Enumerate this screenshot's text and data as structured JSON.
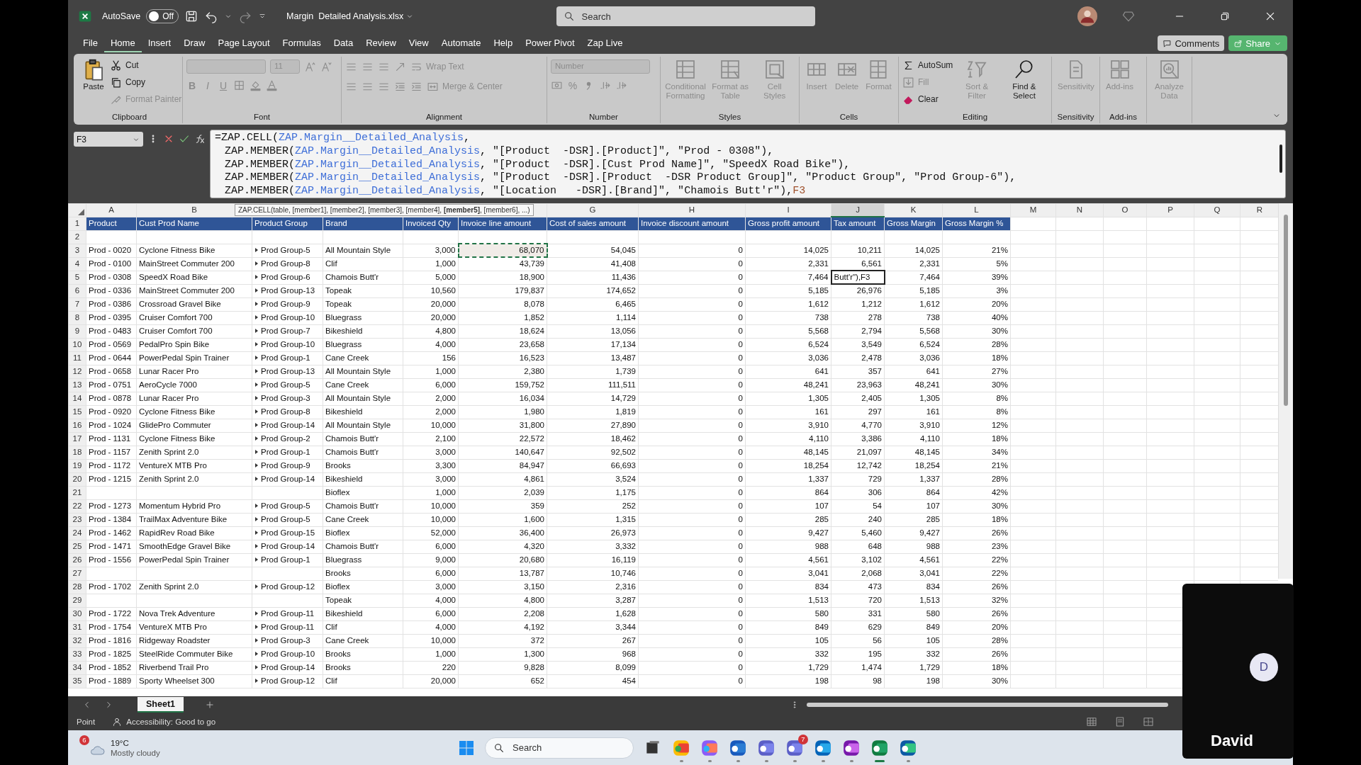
{
  "title_bar": {
    "autosave_label": "AutoSave",
    "autosave": {
      "on": false,
      "label": "Off"
    },
    "file_name": "Margin  Detailed Analysis.xlsx",
    "search_placeholder": "Search"
  },
  "tabs": [
    {
      "label": "File",
      "selected": false
    },
    {
      "label": "Home",
      "selected": true
    },
    {
      "label": "Insert",
      "selected": false
    },
    {
      "label": "Draw",
      "selected": false
    },
    {
      "label": "Page Layout",
      "selected": false
    },
    {
      "label": "Formulas",
      "selected": false
    },
    {
      "label": "Data",
      "selected": false
    },
    {
      "label": "Review",
      "selected": false
    },
    {
      "label": "View",
      "selected": false
    },
    {
      "label": "Automate",
      "selected": false
    },
    {
      "label": "Help",
      "selected": false
    },
    {
      "label": "Power Pivot",
      "selected": false
    },
    {
      "label": "Zap Live",
      "selected": false
    }
  ],
  "buttons": {
    "comments": "Comments",
    "share": "Share"
  },
  "ribbon": {
    "clipboard": {
      "label": "Clipboard",
      "paste": {
        "label": "Paste",
        "disabled": false
      },
      "cut": {
        "label": "Cut",
        "disabled": false
      },
      "copy": {
        "label": "Copy",
        "disabled": false
      },
      "format_painter": {
        "label": "Format Painter",
        "disabled": true
      }
    },
    "font": {
      "label": "Font",
      "size": "11",
      "bold": "B",
      "italic": "I",
      "underline": "U"
    },
    "alignment": {
      "label": "Alignment",
      "wrap_text": "Wrap Text",
      "merge_center": "Merge & Center"
    },
    "number": {
      "label": "Number",
      "format": "Number",
      "percent": "%"
    },
    "styles": {
      "label": "Styles",
      "conditional_formatting": "Conditional Formatting",
      "format_as_table": "Format as Table",
      "cell_styles": "Cell Styles"
    },
    "cells": {
      "label": "Cells",
      "insert": "Insert",
      "delete": "Delete",
      "format": "Format"
    },
    "editing": {
      "label": "Editing",
      "autosum": {
        "label": "AutoSum",
        "disabled": false
      },
      "fill": {
        "label": "Fill",
        "disabled": true
      },
      "clear": {
        "label": "Clear",
        "disabled": false
      },
      "sort_filter": {
        "label": "Sort & Filter",
        "disabled": true
      },
      "find_select": {
        "label": "Find & Select",
        "disabled": false
      }
    },
    "sensitivity": {
      "label": "Sensitivity",
      "button": "Sensitivity"
    },
    "add_ins": {
      "label": "Add-ins",
      "button": "Add-ins"
    },
    "analyze_data": "Analyze Data"
  },
  "formula_bar": {
    "name_box": "F3",
    "lines": [
      [
        {
          "text": "=ZAP.CELL(",
          "kind": "plain"
        },
        {
          "text": "ZAP.Margin__Detailed_Analysis",
          "kind": "ref"
        },
        {
          "text": ",",
          "kind": "plain"
        }
      ],
      [
        {
          "text": "ZAP.MEMBER(",
          "kind": "plain"
        },
        {
          "text": "ZAP.Margin__Detailed_Analysis",
          "kind": "ref"
        },
        {
          "text": ", \"[Product  -DSR].[Product]\", \"Prod - 0308\"),",
          "kind": "plain"
        }
      ],
      [
        {
          "text": "ZAP.MEMBER(",
          "kind": "plain"
        },
        {
          "text": "ZAP.Margin__Detailed_Analysis",
          "kind": "ref"
        },
        {
          "text": ", \"[Product  -DSR].[Cust Prod Name]\", \"SpeedX Road Bike\"),",
          "kind": "plain"
        }
      ],
      [
        {
          "text": "ZAP.MEMBER(",
          "kind": "plain"
        },
        {
          "text": "ZAP.Margin__Detailed_Analysis",
          "kind": "ref"
        },
        {
          "text": ", \"[Product  -DSR].[Product  -DSR Product Group]\", \"Product Group\", \"Prod Group-6\"),",
          "kind": "plain"
        }
      ],
      [
        {
          "text": "ZAP.MEMBER(",
          "kind": "plain"
        },
        {
          "text": "ZAP.Margin__Detailed_Analysis",
          "kind": "ref"
        },
        {
          "text": ", \"[Location   -DSR].[Brand]\", \"Chamois Butt'r\"),",
          "kind": "plain"
        },
        {
          "text": "F3",
          "kind": "cell"
        }
      ]
    ]
  },
  "tooltip": "ZAP.CELL(table, [member1], [member2], [member3], [member4], **[member5]**, [member6], ...)",
  "grid": {
    "columns": [
      {
        "letter": "A",
        "selected": false
      },
      {
        "letter": "B",
        "selected": false
      },
      {
        "selected": false
      },
      {
        "selected": false
      },
      {
        "selected": false
      },
      {
        "selected": false
      },
      {
        "letter": "G",
        "selected": false
      },
      {
        "letter": "H",
        "selected": false
      },
      {
        "letter": "I",
        "selected": false
      },
      {
        "letter": "J",
        "selected": true
      },
      {
        "letter": "K",
        "selected": false
      },
      {
        "letter": "L",
        "selected": false
      },
      {
        "letter": "M",
        "selected": false
      },
      {
        "letter": "N",
        "selected": false
      },
      {
        "letter": "O",
        "selected": false
      },
      {
        "letter": "P",
        "selected": false
      },
      {
        "letter": "Q",
        "selected": false
      },
      {
        "letter": "R",
        "selected": false
      }
    ],
    "rows": [
      {
        "number": "1",
        "kind": "header",
        "cells": [
          "Product",
          "Cust Prod Name",
          "Product Group",
          "Brand",
          "Invoiced Qty",
          "Invoice line amount",
          "Cost of sales amount",
          "Invoice discount amount",
          "Gross profit amount",
          "Tax amount",
          "Gross Margin",
          "Gross Margin %"
        ]
      },
      {
        "number": "2",
        "kind": "blank"
      },
      {
        "number": "3",
        "kind": "data",
        "cells": [
          "Prod - 0020",
          "Cyclone Fitness Bike",
          "Prod Group-5",
          "All Mountain Style",
          "3,000",
          {
            "text": "68,070",
            "copied": true
          },
          "54,045",
          "0",
          "14,025",
          "10,211",
          "14,025",
          "21%"
        ]
      },
      {
        "number": "4",
        "kind": "data",
        "cells": [
          "Prod - 0100",
          "MainStreet Commuter 200",
          "Prod Group-8",
          "Clif",
          "1,000",
          "43,739",
          "41,408",
          "0",
          "2,331",
          "6,561",
          "2,331",
          "5%"
        ]
      },
      {
        "number": "5",
        "kind": "data",
        "cells": [
          "Prod - 0308",
          "SpeedX Road Bike",
          "Prod Group-6",
          "Chamois Butt'r",
          "5,000",
          "18,900",
          "11,436",
          "0",
          "7,464",
          {
            "text": "Butt'r\"),F3",
            "editing": true
          },
          "7,464",
          "39%"
        ]
      },
      {
        "number": "6",
        "kind": "data",
        "cells": [
          "Prod - 0336",
          "MainStreet Commuter 200",
          "Prod Group-13",
          "Topeak",
          "10,560",
          "179,837",
          "174,652",
          "0",
          "5,185",
          "26,976",
          "5,185",
          "3%"
        ]
      },
      {
        "number": "7",
        "kind": "data",
        "cells": [
          "Prod - 0386",
          "Crossroad Gravel Bike",
          "Prod Group-9",
          "Topeak",
          "20,000",
          "8,078",
          "6,465",
          "0",
          "1,612",
          "1,212",
          "1,612",
          "20%"
        ]
      },
      {
        "number": "8",
        "kind": "data",
        "cells": [
          "Prod - 0395",
          "Cruiser Comfort 700",
          "Prod Group-10",
          "Bluegrass",
          "20,000",
          "1,852",
          "1,114",
          "0",
          "738",
          "278",
          "738",
          "40%"
        ]
      },
      {
        "number": "9",
        "kind": "data",
        "cells": [
          "Prod - 0483",
          "Cruiser Comfort 700",
          "Prod Group-7",
          "Bikeshield",
          "4,800",
          "18,624",
          "13,056",
          "0",
          "5,568",
          "2,794",
          "5,568",
          "30%"
        ]
      },
      {
        "number": "10",
        "kind": "data",
        "cells": [
          "Prod - 0569",
          "PedalPro Spin Bike",
          "Prod Group-10",
          "Bluegrass",
          "4,000",
          "23,658",
          "17,134",
          "0",
          "6,524",
          "3,549",
          "6,524",
          "28%"
        ]
      },
      {
        "number": "11",
        "kind": "data",
        "cells": [
          "Prod - 0644",
          "PowerPedal Spin Trainer",
          "Prod Group-1",
          "Cane Creek",
          "156",
          "16,523",
          "13,487",
          "0",
          "3,036",
          "2,478",
          "3,036",
          "18%"
        ]
      },
      {
        "number": "12",
        "kind": "data",
        "cells": [
          "Prod - 0658",
          "Lunar Racer Pro",
          "Prod Group-13",
          "All Mountain Style",
          "1,000",
          "2,380",
          "1,739",
          "0",
          "641",
          "357",
          "641",
          "27%"
        ]
      },
      {
        "number": "13",
        "kind": "data",
        "cells": [
          "Prod - 0751",
          "AeroCycle 7000",
          "Prod Group-5",
          "Cane Creek",
          "6,000",
          "159,752",
          "111,511",
          "0",
          "48,241",
          "23,963",
          "48,241",
          "30%"
        ]
      },
      {
        "number": "14",
        "kind": "data",
        "cells": [
          "Prod - 0878",
          "Lunar Racer Pro",
          "Prod Group-3",
          "All Mountain Style",
          "2,000",
          "16,034",
          "14,729",
          "0",
          "1,305",
          "2,405",
          "1,305",
          "8%"
        ]
      },
      {
        "number": "15",
        "kind": "data",
        "cells": [
          "Prod - 0920",
          "Cyclone Fitness Bike",
          "Prod Group-8",
          "Bikeshield",
          "2,000",
          "1,980",
          "1,819",
          "0",
          "161",
          "297",
          "161",
          "8%"
        ]
      },
      {
        "number": "16",
        "kind": "data",
        "cells": [
          "Prod - 1024",
          "GlidePro Commuter",
          "Prod Group-14",
          "All Mountain Style",
          "10,000",
          "31,800",
          "27,890",
          "0",
          "3,910",
          "4,770",
          "3,910",
          "12%"
        ]
      },
      {
        "number": "17",
        "kind": "data",
        "cells": [
          "Prod - 1131",
          "Cyclone Fitness Bike",
          "Prod Group-2",
          "Chamois Butt'r",
          "2,100",
          "22,572",
          "18,462",
          "0",
          "4,110",
          "3,386",
          "4,110",
          "18%"
        ]
      },
      {
        "number": "18",
        "kind": "data",
        "cells": [
          "Prod - 1157",
          "Zenith Sprint 2.0",
          "Prod Group-1",
          "Chamois Butt'r",
          "3,000",
          "140,647",
          "92,502",
          "0",
          "48,145",
          "21,097",
          "48,145",
          "34%"
        ]
      },
      {
        "number": "19",
        "kind": "data",
        "cells": [
          "Prod - 1172",
          "VentureX MTB Pro",
          "Prod Group-9",
          "Brooks",
          "3,300",
          "84,947",
          "66,693",
          "0",
          "18,254",
          "12,742",
          "18,254",
          "21%"
        ]
      },
      {
        "number": "20",
        "kind": "data",
        "cells": [
          "Prod - 1215",
          "Zenith Sprint 2.0",
          "Prod Group-14",
          "Bikeshield",
          "3,000",
          "4,861",
          "3,524",
          "0",
          "1,337",
          "729",
          "1,337",
          "28%"
        ]
      },
      {
        "number": "21",
        "kind": "data",
        "cells": [
          null,
          null,
          null,
          "Bioflex",
          "1,000",
          "2,039",
          "1,175",
          "0",
          "864",
          "306",
          "864",
          "42%"
        ]
      },
      {
        "number": "22",
        "kind": "data",
        "cells": [
          "Prod - 1273",
          "Momentum Hybrid Pro",
          "Prod Group-5",
          "Chamois Butt'r",
          "10,000",
          "359",
          "252",
          "0",
          "107",
          "54",
          "107",
          "30%"
        ]
      },
      {
        "number": "23",
        "kind": "data",
        "cells": [
          "Prod - 1384",
          "TrailMax Adventure Bike",
          "Prod Group-5",
          "Cane Creek",
          "10,000",
          "1,600",
          "1,315",
          "0",
          "285",
          "240",
          "285",
          "18%"
        ]
      },
      {
        "number": "24",
        "kind": "data",
        "cells": [
          "Prod - 1462",
          "RapidRev Road Bike",
          "Prod Group-15",
          "Bioflex",
          "52,000",
          "36,400",
          "26,973",
          "0",
          "9,427",
          "5,460",
          "9,427",
          "26%"
        ]
      },
      {
        "number": "25",
        "kind": "data",
        "cells": [
          "Prod - 1471",
          "SmoothEdge Gravel Bike",
          "Prod Group-14",
          "Chamois Butt'r",
          "6,000",
          "4,320",
          "3,332",
          "0",
          "988",
          "648",
          "988",
          "23%"
        ]
      },
      {
        "number": "26",
        "kind": "data",
        "cells": [
          "Prod - 1556",
          "PowerPedal Spin Trainer",
          "Prod Group-1",
          "Bluegrass",
          "9,000",
          "20,680",
          "16,119",
          "0",
          "4,561",
          "3,102",
          "4,561",
          "22%"
        ]
      },
      {
        "number": "27",
        "kind": "data",
        "cells": [
          null,
          null,
          null,
          "Brooks",
          "6,000",
          "13,787",
          "10,746",
          "0",
          "3,041",
          "2,068",
          "3,041",
          "22%"
        ]
      },
      {
        "number": "28",
        "kind": "data",
        "cells": [
          "Prod - 1702",
          "Zenith Sprint 2.0",
          "Prod Group-12",
          "Bioflex",
          "3,000",
          "3,150",
          "2,316",
          "0",
          "834",
          "473",
          "834",
          "26%"
        ]
      },
      {
        "number": "29",
        "kind": "data",
        "cells": [
          null,
          null,
          null,
          "Topeak",
          "4,000",
          "4,800",
          "3,287",
          "0",
          "1,513",
          "720",
          "1,513",
          "32%"
        ]
      },
      {
        "number": "30",
        "kind": "data",
        "cells": [
          "Prod - 1722",
          "Nova Trek Adventure",
          "Prod Group-11",
          "Bikeshield",
          "6,000",
          "2,208",
          "1,628",
          "0",
          "580",
          "331",
          "580",
          "26%"
        ]
      },
      {
        "number": "31",
        "kind": "data",
        "cells": [
          "Prod - 1754",
          "VentureX MTB Pro",
          "Prod Group-11",
          "Clif",
          "4,000",
          "4,192",
          "3,344",
          "0",
          "849",
          "629",
          "849",
          "20%"
        ]
      },
      {
        "number": "32",
        "kind": "data",
        "cells": [
          "Prod - 1816",
          "Ridgeway Roadster",
          "Prod Group-3",
          "Cane Creek",
          "10,000",
          "372",
          "267",
          "0",
          "105",
          "56",
          "105",
          "28%"
        ]
      },
      {
        "number": "33",
        "kind": "data",
        "cells": [
          "Prod - 1825",
          "SteelRide Commuter Bike",
          "Prod Group-10",
          "Brooks",
          "1,000",
          "1,300",
          "968",
          "0",
          "332",
          "195",
          "332",
          "26%"
        ]
      },
      {
        "number": "34",
        "kind": "data",
        "cells": [
          "Prod - 1852",
          "Riverbend Trail Pro",
          "Prod Group-14",
          "Brooks",
          "220",
          "9,828",
          "8,099",
          "0",
          "1,729",
          "1,474",
          "1,729",
          "18%"
        ]
      },
      {
        "number": "35",
        "kind": "data",
        "cells": [
          "Prod - 1889",
          "Sporty Wheelset 300",
          "Prod Group-12",
          "Clif",
          "20,000",
          "652",
          "454",
          "0",
          "198",
          "98",
          "198",
          "30%"
        ]
      }
    ]
  },
  "sheets": [
    {
      "name": "Sheet1",
      "selected": true
    }
  ],
  "status_bar": {
    "mode": "Point",
    "accessibility": "Accessibility: Good to go"
  },
  "taskbar": {
    "weather": {
      "badge": "6",
      "temperature": "19°C",
      "condition": "Mostly cloudy"
    },
    "search_placeholder": "Search",
    "apps": [
      {
        "selected": false
      },
      {
        "selected": false
      },
      {
        "selected": false
      },
      {
        "selected": false
      },
      {
        "selected": false,
        "badge": "7"
      },
      {
        "selected": false
      },
      {
        "selected": false
      },
      {
        "selected": true
      },
      {
        "selected": false
      }
    ]
  },
  "call_tile": {
    "initial": "D",
    "name": "David"
  }
}
